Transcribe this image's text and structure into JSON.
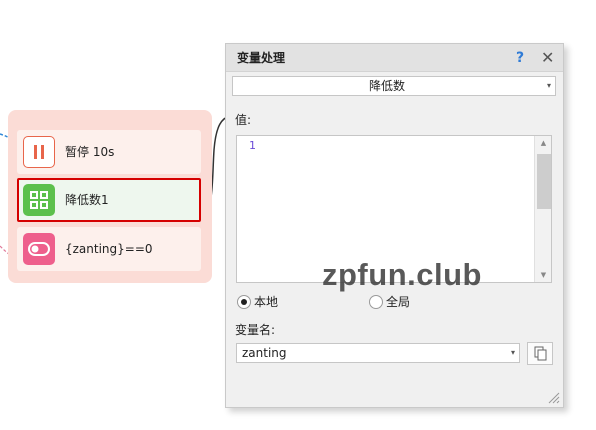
{
  "flow": {
    "nodes": [
      {
        "label": "暂停 10s",
        "icon": "pause-icon"
      },
      {
        "label": "降低数1",
        "icon": "grid-icon",
        "selected": true
      },
      {
        "label": "{zanting}==0",
        "icon": "toggle-icon"
      }
    ]
  },
  "panel": {
    "title": "变量处理",
    "help": "?",
    "close": "✕",
    "operation": {
      "selected": "降低数",
      "caret": "▾"
    },
    "value_label": "值:",
    "editor": {
      "line_number": "1",
      "up": "▲",
      "down": "▼"
    },
    "scope": {
      "options": [
        {
          "label": "本地",
          "checked": true
        },
        {
          "label": "全局",
          "checked": false
        }
      ]
    },
    "variable_label": "变量名:",
    "variable": {
      "selected": "zanting",
      "caret": "▾"
    }
  },
  "watermark": "zpfun.club",
  "colors": {
    "group_bg": "#fbdcd6",
    "node_bg": "#fdf0ec",
    "selected_border": "#d50000",
    "pause_icon": "#e8654a",
    "grid_icon": "#5cc04c",
    "toggle_icon": "#ee5f8c",
    "connector_blue": "#2f86d6",
    "help_blue": "#2f7bd6"
  }
}
